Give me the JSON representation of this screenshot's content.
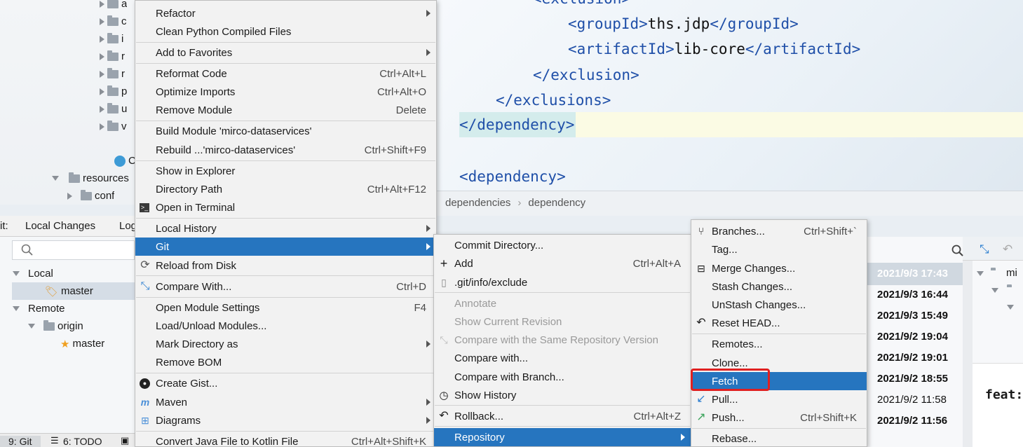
{
  "project_tree": {
    "rows": [
      {
        "label": "a"
      },
      {
        "label": "c"
      },
      {
        "label": "i"
      },
      {
        "label": "r"
      },
      {
        "label": "r"
      },
      {
        "label": "p"
      },
      {
        "label": "u"
      },
      {
        "label": "v"
      },
      {
        "label": "C"
      },
      {
        "label": "resources"
      },
      {
        "label": "conf"
      }
    ]
  },
  "editor": {
    "lines": [
      {
        "open": "<",
        "tag": "exclusion",
        "close": ">"
      },
      {
        "open": "<groupId>",
        "text": "ths.jdp",
        "close": "</groupId>"
      },
      {
        "open": "<artifactId>",
        "text": "lib-core",
        "close": "</artifactId>"
      },
      {
        "text": "</exclusion>"
      },
      {
        "text": "</exclusions>"
      },
      {
        "text": "</dependency>"
      },
      {
        "text": "<dependency>"
      }
    ],
    "breadcrumb": [
      "dependencies",
      "dependency"
    ]
  },
  "git_window": {
    "prefix": "it:",
    "tabs": [
      "Local Changes",
      "Log"
    ],
    "branches": {
      "local_label": "Local",
      "local_items": [
        "master"
      ],
      "remote_label": "Remote",
      "remote_origin": "origin",
      "remote_items": [
        "master"
      ]
    }
  },
  "status_bar": {
    "git_tab": "9: Git",
    "todo_tab": "6: TODO"
  },
  "context_menu": {
    "items": [
      {
        "label": "Refactor",
        "shortcut": "",
        "submenu": true
      },
      {
        "label": "Clean Python Compiled Files",
        "shortcut": ""
      },
      {
        "label": "Add to Favorites",
        "shortcut": "",
        "submenu": true
      },
      {
        "label": "Reformat Code",
        "shortcut": "Ctrl+Alt+L"
      },
      {
        "label": "Optimize Imports",
        "shortcut": "Ctrl+Alt+O"
      },
      {
        "label": "Remove Module",
        "shortcut": "Delete"
      },
      {
        "label": "Build Module 'mirco-dataservices'",
        "shortcut": ""
      },
      {
        "label": "Rebuild ...'mirco-dataservices'",
        "shortcut": "Ctrl+Shift+F9"
      },
      {
        "label": "Show in Explorer",
        "shortcut": ""
      },
      {
        "label": "Directory Path",
        "shortcut": "Ctrl+Alt+F12"
      },
      {
        "label": "Open in Terminal",
        "shortcut": ""
      },
      {
        "label": "Local History",
        "shortcut": "",
        "submenu": true
      },
      {
        "label": "Git",
        "shortcut": "",
        "submenu": true
      },
      {
        "label": "Reload from Disk",
        "shortcut": ""
      },
      {
        "label": "Compare With...",
        "shortcut": "Ctrl+D"
      },
      {
        "label": "Open Module Settings",
        "shortcut": "F4"
      },
      {
        "label": "Load/Unload Modules...",
        "shortcut": ""
      },
      {
        "label": "Mark Directory as",
        "shortcut": "",
        "submenu": true
      },
      {
        "label": "Remove BOM",
        "shortcut": ""
      },
      {
        "label": "Create Gist...",
        "shortcut": ""
      },
      {
        "label": "Maven",
        "shortcut": "",
        "submenu": true
      },
      {
        "label": "Diagrams",
        "shortcut": "",
        "submenu": true
      },
      {
        "label": "Convert Java File to Kotlin File",
        "shortcut": "Ctrl+Alt+Shift+K"
      }
    ]
  },
  "git_submenu": {
    "items": [
      {
        "label": "Commit Directory...",
        "shortcut": ""
      },
      {
        "label": "Add",
        "shortcut": "Ctrl+Alt+A"
      },
      {
        "label": ".git/info/exclude",
        "shortcut": ""
      },
      {
        "label": "Annotate",
        "shortcut": ""
      },
      {
        "label": "Show Current Revision",
        "shortcut": ""
      },
      {
        "label": "Compare with the Same Repository Version",
        "shortcut": ""
      },
      {
        "label": "Compare with...",
        "shortcut": ""
      },
      {
        "label": "Compare with Branch...",
        "shortcut": ""
      },
      {
        "label": "Show History",
        "shortcut": ""
      },
      {
        "label": "Rollback...",
        "shortcut": "Ctrl+Alt+Z"
      },
      {
        "label": "Repository",
        "shortcut": "",
        "submenu": true
      }
    ]
  },
  "repository_submenu": {
    "items": [
      {
        "label": "Branches...",
        "shortcut": "Ctrl+Shift+`"
      },
      {
        "label": "Tag...",
        "shortcut": ""
      },
      {
        "label": "Merge Changes...",
        "shortcut": ""
      },
      {
        "label": "Stash Changes...",
        "shortcut": ""
      },
      {
        "label": "UnStash Changes...",
        "shortcut": ""
      },
      {
        "label": "Reset HEAD...",
        "shortcut": ""
      },
      {
        "label": "Remotes...",
        "shortcut": ""
      },
      {
        "label": "Clone...",
        "shortcut": ""
      },
      {
        "label": "Fetch",
        "shortcut": ""
      },
      {
        "label": "Pull...",
        "shortcut": ""
      },
      {
        "label": "Push...",
        "shortcut": "Ctrl+Shift+K"
      },
      {
        "label": "Rebase...",
        "shortcut": ""
      }
    ]
  },
  "log_dates": [
    "2021/9/3 17:43",
    "2021/9/3 16:44",
    "2021/9/3 15:49",
    "2021/9/2 19:04",
    "2021/9/2 19:01",
    "2021/9/2 18:55",
    "2021/9/2 11:58",
    "2021/9/2 11:56"
  ],
  "details_text": "feat:",
  "colors": {
    "selection": "#2675bf",
    "highlight_box": "#e02020",
    "xml_tag": "#1f4fa8"
  }
}
